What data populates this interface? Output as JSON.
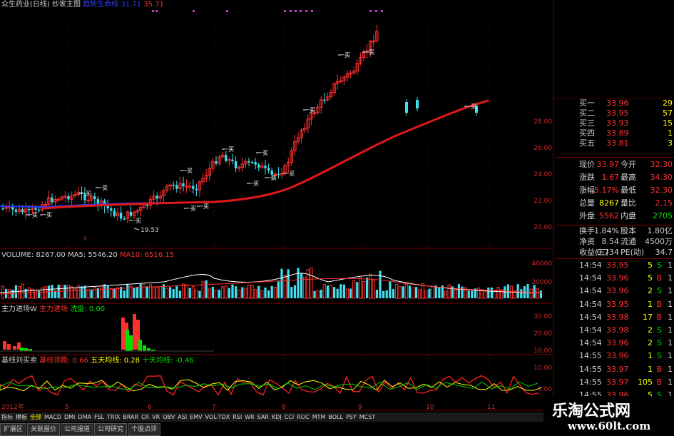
{
  "main_header": {
    "stock": "众生药业(日线)",
    "indicator": "炒家主图",
    "label": "趋势生命线",
    "v1": "31.71",
    "v2": "35.71"
  },
  "price_axis": [
    "28.00",
    "26.00",
    "24.00",
    "22.00",
    "20.00"
  ],
  "low_label": "19.53",
  "kline_marker": "一买",
  "volume": {
    "label": "VOLUME: 8267.00",
    "ma5": "MA5: 5546.20",
    "ma10": "MA10: 6516.15",
    "axis": [
      "40000",
      "20000"
    ]
  },
  "capital": {
    "title": "主力进场W",
    "main": "主力进场",
    "wash": "洗盘: 0.00",
    "axis": [
      "30.00",
      "20.00",
      "10.00"
    ]
  },
  "kdj": {
    "title": "基线刘买卖",
    "lead": "基线领跑: 0.66",
    "five": "五天均线: 0.28",
    "ten": "十天均线: -0.46",
    "axis": [
      "10.00",
      "0.00"
    ]
  },
  "date_axis": [
    "2012年",
    "5",
    "6",
    "7",
    "8",
    "9",
    "10",
    "11"
  ],
  "order_book": [
    {
      "label": "买一",
      "price": "33.96",
      "vol": "29"
    },
    {
      "label": "买二",
      "price": "33.95",
      "vol": "57"
    },
    {
      "label": "买三",
      "price": "33.93",
      "vol": "15"
    },
    {
      "label": "买四",
      "price": "33.89",
      "vol": "1"
    },
    {
      "label": "买五",
      "price": "33.81",
      "vol": "3"
    }
  ],
  "quote": [
    {
      "l1": "现价",
      "v1": "33.97",
      "l2": "今开",
      "v2": "32.30",
      "c1": "#ff3030",
      "c2": "#ff3030"
    },
    {
      "l1": "涨跌",
      "v1": "1.67",
      "l2": "最高",
      "v2": "34.30",
      "c1": "#ff3030",
      "c2": "#ff3030"
    },
    {
      "l1": "涨幅",
      "v1": "5.17%",
      "l2": "最低",
      "v2": "32.30",
      "c1": "#ff3030",
      "c2": "#ff3030"
    },
    {
      "l1": "总量",
      "v1": "8267",
      "l2": "量比",
      "v2": "2.15",
      "c1": "#ffff00",
      "c2": "#ff3030"
    },
    {
      "l1": "外盘",
      "v1": "5562",
      "l2": "内盘",
      "v2": "2705",
      "c1": "#ff3030",
      "c2": "#00e000"
    }
  ],
  "stats": [
    {
      "l1": "换手",
      "v1": "1.84%",
      "l2": "股本",
      "v2": "1.80亿"
    },
    {
      "l1": "净资",
      "v1": "8.54",
      "l2": "流通",
      "v2": "4500万"
    },
    {
      "l1": "收益(三)",
      "v1": "0.734",
      "l2": "PE(动)",
      "v2": "34.7"
    }
  ],
  "trades": [
    {
      "time": "14:54",
      "price": "33.95",
      "vol": "5",
      "side": "S",
      "n": "1"
    },
    {
      "time": "14:54",
      "price": "33.96",
      "vol": "5",
      "side": "B",
      "n": "1"
    },
    {
      "time": "14:54",
      "price": "33.96",
      "vol": "2",
      "side": "S",
      "n": "1"
    },
    {
      "time": "14:54",
      "price": "33.95",
      "vol": "1",
      "side": "B",
      "n": "1"
    },
    {
      "time": "14:54",
      "price": "33.98",
      "vol": "17",
      "side": "B",
      "n": "1"
    },
    {
      "time": "14:54",
      "price": "33.98",
      "vol": "2",
      "side": "S",
      "n": "1"
    },
    {
      "time": "14:54",
      "price": "33.96",
      "vol": "2",
      "side": "S",
      "n": "1"
    },
    {
      "time": "14:55",
      "price": "33.96",
      "vol": "1",
      "side": "S",
      "n": "1"
    },
    {
      "time": "14:55",
      "price": "33.97",
      "vol": "1",
      "side": "B",
      "n": "1"
    },
    {
      "time": "14:55",
      "price": "33.97",
      "vol": "105",
      "side": "B",
      "n": "1"
    },
    {
      "time": "14:55",
      "price": "33.96",
      "vol": "5",
      "side": "S",
      "n": "1"
    }
  ],
  "tabs": [
    "指标",
    "模板",
    "全部",
    "MACD",
    "DMI",
    "DMA",
    "FSL",
    "TRIX",
    "BRAR",
    "CR",
    "VR",
    "OBV",
    "ASI",
    "EMV",
    "VOL-TDX",
    "RSI",
    "WR",
    "SAR",
    "KDJ",
    "CCI",
    "ROC",
    "MTM",
    "BOLL",
    "PSY",
    "MCST"
  ],
  "active_tab": "全部",
  "bottom_tabs": [
    "扩展区",
    "关联报价",
    "公司报道",
    "公司研究",
    "个股点评"
  ],
  "watermark": {
    "title": "乐淘公式网",
    "url": "www.60lt.com"
  },
  "colors": {
    "up": "#ff3030",
    "down": "#40e0f0",
    "ma_red": "#e01818",
    "ma_blue": "#2a3cff",
    "grid": "#7a0000",
    "green": "#00e000",
    "yellow": "#ffff00"
  }
}
